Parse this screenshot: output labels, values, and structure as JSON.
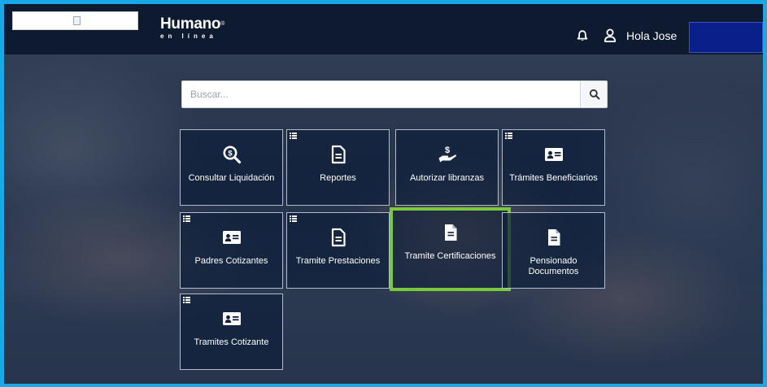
{
  "header": {
    "logo_brand": "Humano",
    "logo_mark": "®",
    "logo_sub": "en línea",
    "greeting": "Hola Jose",
    "bell_icon": "bell-icon",
    "user_icon": "user-icon"
  },
  "search": {
    "placeholder": "Buscar...",
    "value": "",
    "button_icon": "search-icon"
  },
  "tiles": [
    {
      "label": "Consultar Liquidación",
      "icon": "search-dollar-icon",
      "menu": false
    },
    {
      "label": "Reportes",
      "icon": "document-icon",
      "menu": true
    },
    {
      "label": "Autorizar libranzas",
      "icon": "hand-dollar-icon",
      "menu": false
    },
    {
      "label": "Trámites Beneficiarios",
      "icon": "id-card-icon",
      "menu": true
    },
    {
      "label": "Padres Cotizantes",
      "icon": "id-card-icon",
      "menu": true
    },
    {
      "label": "Tramite Prestaciones",
      "icon": "document-icon",
      "menu": true
    },
    {
      "label": "Tramite Certificaciones",
      "icon": "file-icon",
      "menu": false,
      "selected": true
    },
    {
      "label": "Pensionado Documentos",
      "icon": "file-icon",
      "menu": false
    },
    {
      "label": "Tramites Cotizante",
      "icon": "id-card-icon",
      "menu": true
    }
  ],
  "colors": {
    "frame_border": "#18a9e6",
    "header_bg": "#0d1a30",
    "highlight": "#79c93b",
    "name_box": "#0b1f8a"
  }
}
